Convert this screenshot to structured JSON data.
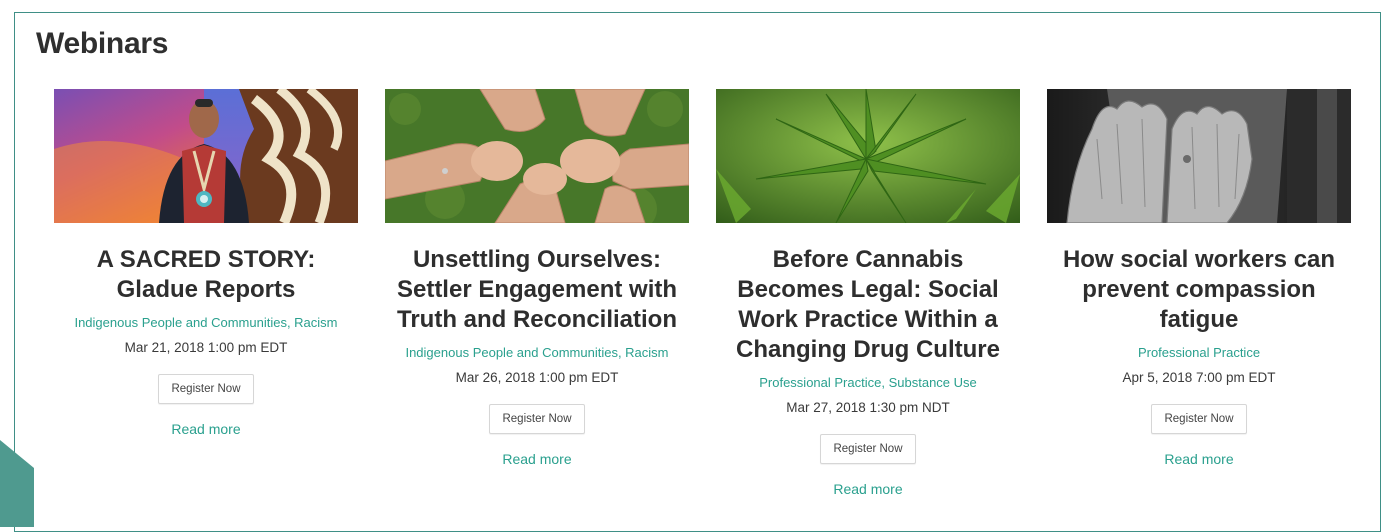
{
  "section": {
    "title": "Webinars"
  },
  "colors": {
    "accent": "#2aa08e",
    "frame": "#3f8f86",
    "title": "#2e2e2e"
  },
  "cards": [
    {
      "title_lines": [
        "A SACRED STORY:",
        "Gladue Reports"
      ],
      "tags": [
        "Indigenous People and Communities",
        "Racism"
      ],
      "date": "Mar 21, 2018 1:00 pm EDT",
      "register_label": "Register Now",
      "read_more_label": "Read more",
      "image": "man-in-ribbon-shirt-photo"
    },
    {
      "title_lines": [
        "Unsettling Ourselves:",
        "Settler Engagement with",
        "Truth and Reconciliation"
      ],
      "tags": [
        "Indigenous People and Communities",
        "Racism"
      ],
      "date": "Mar 26, 2018 1:00 pm EDT",
      "register_label": "Register Now",
      "read_more_label": "Read more",
      "image": "linked-hands-photo"
    },
    {
      "title_lines": [
        "Before Cannabis",
        "Becomes Legal: Social",
        "Work Practice Within a",
        "Changing Drug Culture"
      ],
      "tags": [
        "Professional Practice",
        "Substance Use"
      ],
      "date": "Mar 27, 2018 1:30 pm NDT",
      "register_label": "Register Now",
      "read_more_label": "Read more",
      "image": "cannabis-leaves-photo"
    },
    {
      "title_lines": [
        "How social workers can",
        "prevent compassion",
        "fatigue"
      ],
      "tags": [
        "Professional Practice"
      ],
      "date": "Apr 5, 2018 7:00 pm EDT",
      "register_label": "Register Now",
      "read_more_label": "Read more",
      "image": "hands-over-face-photo"
    }
  ]
}
